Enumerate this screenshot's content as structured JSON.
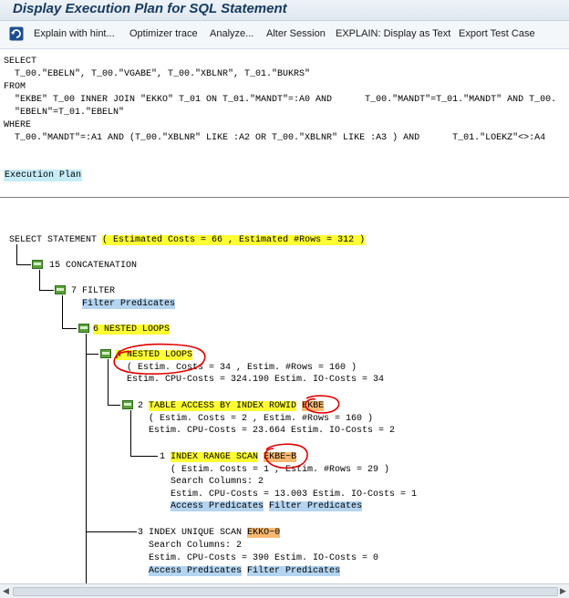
{
  "title": "Display Execution Plan for SQL Statement",
  "toolbar": {
    "icon": "refresh-icon",
    "buttons": [
      "Explain with hint...",
      "Optimizer trace",
      "Analyze...",
      "Alter Session",
      "EXPLAIN: Display as Text",
      "Export Test Case"
    ]
  },
  "sql": {
    "select_kw": "SELECT",
    "select_cols": "  T_00.\"EBELN\", T_00.\"VGABE\", T_00.\"XBLNR\", T_01.\"BUKRS\"",
    "from_kw": "FROM",
    "from_line1": "  \"EKBE\" T_00 INNER JOIN \"EKKO\" T_01 ON T_01.\"MANDT\"=:A0 AND      T_00.\"MANDT\"=T_01.\"MANDT\" AND T_00.",
    "from_line2": "  \"EBELN\"=T_01.\"EBELN\"",
    "where_kw": "WHERE",
    "where_line": "  T_00.\"MANDT\"=:A1 AND (T_00.\"XBLNR\" LIKE :A2 OR T_00.\"XBLNR\" LIKE :A3 ) AND      T_01.\"LOEKZ\"<>:A4"
  },
  "execution_plan_label": "Execution Plan",
  "plan": {
    "root": {
      "label": "SELECT STATEMENT",
      "costs": "( Estimated Costs = 66 , Estimated #Rows = 312 )"
    },
    "n15": {
      "id": "15",
      "name": "CONCATENATION"
    },
    "n7": {
      "id": "7",
      "name": "FILTER",
      "link": "Filter Predicates"
    },
    "n6": {
      "id": "6",
      "name": "NESTED LOOPS"
    },
    "n4": {
      "id": "4",
      "name": "NESTED LOOPS",
      "line1": "( Estim. Costs = 34 , Estim. #Rows = 160 )",
      "line2": "Estim. CPU-Costs = 324.190 Estim. IO-Costs = 34"
    },
    "n2": {
      "id": "2",
      "name": "TABLE ACCESS BY INDEX ROWID",
      "object": "EKBE",
      "line1": "( Estim. Costs = 2 , Estim. #Rows = 160 )",
      "line2": "Estim. CPU-Costs = 23.664 Estim. IO-Costs = 2"
    },
    "n1": {
      "id": "1",
      "name": "INDEX RANGE SCAN",
      "object": "EKBE~B",
      "line1": "( Estim. Costs = 1 , Estim. #Rows = 29 )",
      "line2": "Search Columns: 2",
      "line3": "Estim. CPU-Costs = 13.003 Estim. IO-Costs = 1",
      "link1": "Access Predicates",
      "link2": "Filter Predicates"
    },
    "n3": {
      "id": "3",
      "name": "INDEX UNIQUE SCAN",
      "object": "EKKO~0",
      "line1": "Search Columns: 2",
      "line2": "Estim. CPU-Costs = 390 Estim. IO-Costs = 0",
      "link1": "Access Predicates",
      "link2": "Filter Predicates"
    }
  },
  "colors": {
    "highlight": "#ffff33",
    "link": "#b4d4f0",
    "object": "#f7b870",
    "ink": "#e00000",
    "folder": "#5aa13a"
  }
}
